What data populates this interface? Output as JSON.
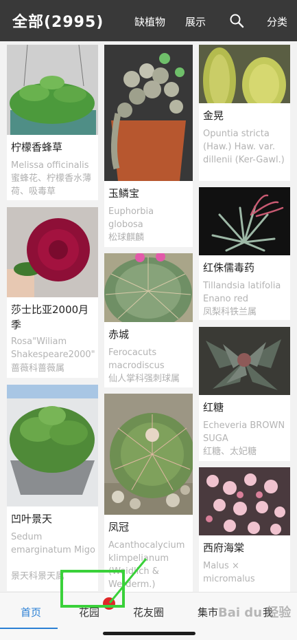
{
  "header": {
    "title": "全部(2995)",
    "actions": [
      "缺植物",
      "展示",
      "分类"
    ]
  },
  "cards": [
    {
      "name": "柠檬香蜂草",
      "latin": "Melissa officinalis",
      "alias": "蜜蜂花、柠檬香水薄荷、吸毒草"
    },
    {
      "name": "莎士比亚2000月季",
      "latin": "Rosa\"Wiliam Shakespeare2000\"",
      "alias": "蔷薇科蔷薇属"
    },
    {
      "name": "凹叶景天",
      "latin": "Sedum emarginatum Migo",
      "alias": "景天科景天属"
    },
    {
      "name": "玉鳞宝",
      "latin": "Euphorbia globosa",
      "alias": "松球麒麟"
    },
    {
      "name": "赤城",
      "latin": "Ferocacuts macrodiscus",
      "alias": "仙人掌科强刺球属"
    },
    {
      "name": "凤冠",
      "latin": "Acanthocalycium klimpelianum (Weidlich & Werderm.)",
      "alias": ""
    },
    {
      "name": "金晃",
      "latin": "Opuntia stricta (Haw.) Haw. var. dillenii (Ker-Gawl.)",
      "alias": ""
    },
    {
      "name": "红侏儒毒药",
      "latin": "Tillandsia latifolia Enano red",
      "alias": "凤梨科铁兰属"
    },
    {
      "name": "红糖",
      "latin": "Echeveria BROWN SUGA",
      "alias": "红糖、太妃糖"
    },
    {
      "name": "西府海棠",
      "latin": "Malus × micromalus",
      "alias": ""
    }
  ],
  "tabs": [
    "首页",
    "花园",
    "花友圈",
    "集市",
    "我"
  ],
  "watermark": "Bai du 经验",
  "colors": {
    "accent": "#2a7fd4",
    "topbar": "#393939",
    "highlight": "#3ad13a",
    "badge": "#e02727"
  }
}
